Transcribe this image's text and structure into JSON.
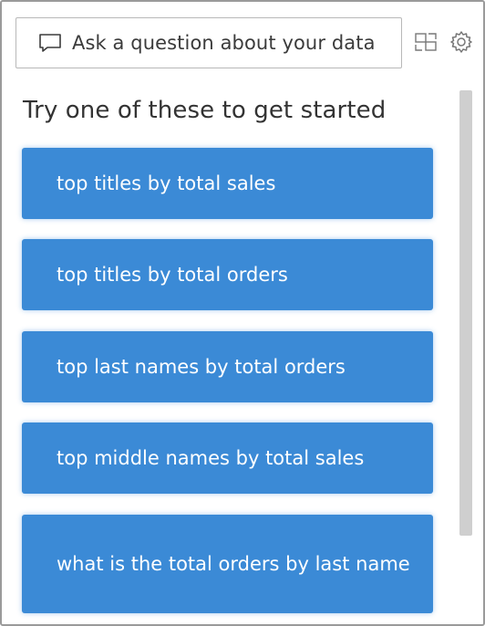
{
  "search": {
    "placeholder": "Ask a question about your data",
    "icon": "chat-bubble-icon"
  },
  "toolbar": {
    "icons": [
      "share-icon",
      "gear-icon"
    ]
  },
  "heading": "Try one of these to get started",
  "suggestions": [
    "top titles by total sales",
    "top titles by total orders",
    "top last names by total orders",
    "top middle names by total sales",
    "what is the total orders by last name"
  ],
  "colors": {
    "suggestion_bg": "#3b8ad6",
    "suggestion_text": "#ffffff",
    "heading_text": "#333333",
    "scrollbar_thumb": "#cfcfcf"
  }
}
